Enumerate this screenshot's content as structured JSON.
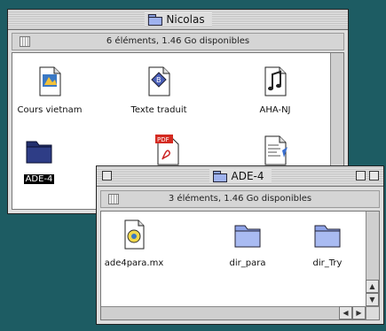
{
  "windows": {
    "back": {
      "title": "Nicolas",
      "status": "6 éléments, 1.46 Go disponibles",
      "items": [
        {
          "label": "Cours vietnam",
          "icon": "document-icon"
        },
        {
          "label": "Texte traduit",
          "icon": "document-icon"
        },
        {
          "label": "AHA-NJ",
          "icon": "music-document-icon"
        },
        {
          "label": "ADE-4",
          "icon": "folder-icon",
          "selected": true
        },
        {
          "label": "",
          "icon": "pdf-document-icon"
        },
        {
          "label": "",
          "icon": "text-document-icon"
        }
      ]
    },
    "front": {
      "title": "ADE-4",
      "status": "3 éléments, 1.46 Go disponibles",
      "items": [
        {
          "label": "ade4para.mx",
          "icon": "app-document-icon"
        },
        {
          "label": "dir_para",
          "icon": "folder-icon"
        },
        {
          "label": "dir_Try",
          "icon": "folder-icon"
        }
      ]
    }
  },
  "colors": {
    "desktop": "#1d5c63",
    "folder": "#9fb2ee",
    "selection": "#000000"
  }
}
